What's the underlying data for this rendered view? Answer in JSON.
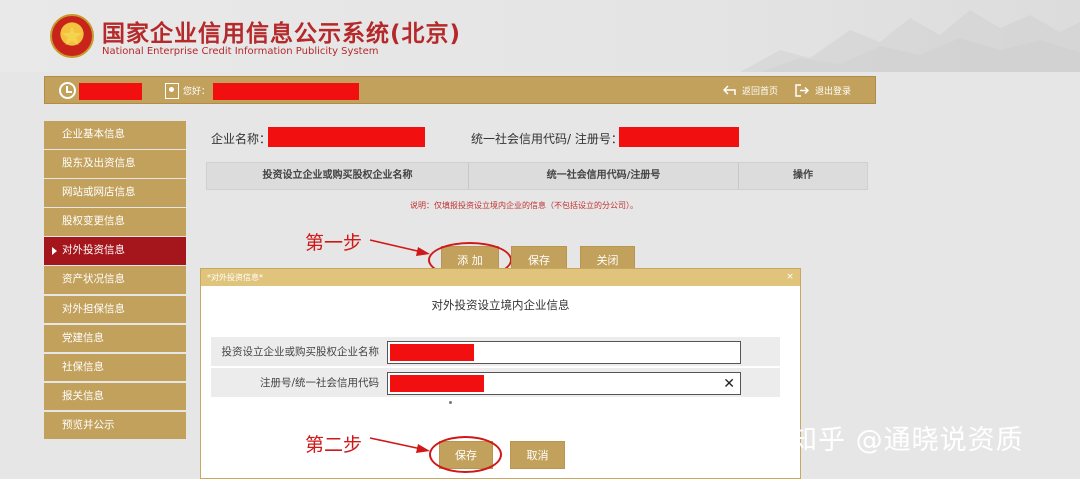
{
  "header": {
    "title": "国家企业信用信息公示系统(北京)",
    "subtitle": "National Enterprise Credit Information Publicity System"
  },
  "topbar": {
    "greeting": "您好：",
    "home_link": "返回首页",
    "logout_link": "退出登录"
  },
  "sidebar": {
    "items": [
      {
        "label": "企业基本信息",
        "active": false
      },
      {
        "label": "股东及出资信息",
        "active": false
      },
      {
        "label": "网站或网店信息",
        "active": false
      },
      {
        "label": "股权变更信息",
        "active": false
      },
      {
        "label": "对外投资信息",
        "active": true
      },
      {
        "label": "资产状况信息",
        "active": false
      },
      {
        "label": "对外担保信息",
        "active": false
      },
      {
        "label": "党建信息",
        "active": false
      },
      {
        "label": "社保信息",
        "active": false
      },
      {
        "label": "报关信息",
        "active": false
      },
      {
        "label": "预览并公示",
        "active": false
      }
    ]
  },
  "main": {
    "company_name_label": "企业名称：",
    "credit_code_label": "统一社会信用代码/ 注册号：",
    "table_headers": [
      "投资设立企业或购买股权企业名称",
      "统一社会信用代码/注册号",
      "操作"
    ],
    "note": "说明：仅填报投资设立境内企业的信息（不包括设立的分公司）。",
    "add_button": "添 加",
    "save_button": "保存",
    "close_button": "关闭"
  },
  "annotations": {
    "step1": "第一步",
    "step2": "第二步"
  },
  "dialog": {
    "titlebar": "*对外投资信息*",
    "close_glyph": "×",
    "heading": "对外投资设立境内企业信息",
    "field_name_label": "投资设立企业或购买股权企业名称",
    "field_code_label": "注册号/统一社会信用代码",
    "clear_glyph": "✕",
    "save_button": "保存",
    "cancel_button": "取消"
  },
  "watermark": "知乎 @通晓说资质",
  "colors": {
    "accent_gold": "#c2a15c",
    "active_red": "#a5161c",
    "title_red": "#b5292a",
    "redaction_red": "#f20f0f",
    "annotation_red": "#d01818"
  },
  "icons": [
    "emblem-icon",
    "clock-icon",
    "user-icon",
    "home-icon",
    "logout-icon",
    "close-icon",
    "clear-icon",
    "arrow-icon"
  ]
}
